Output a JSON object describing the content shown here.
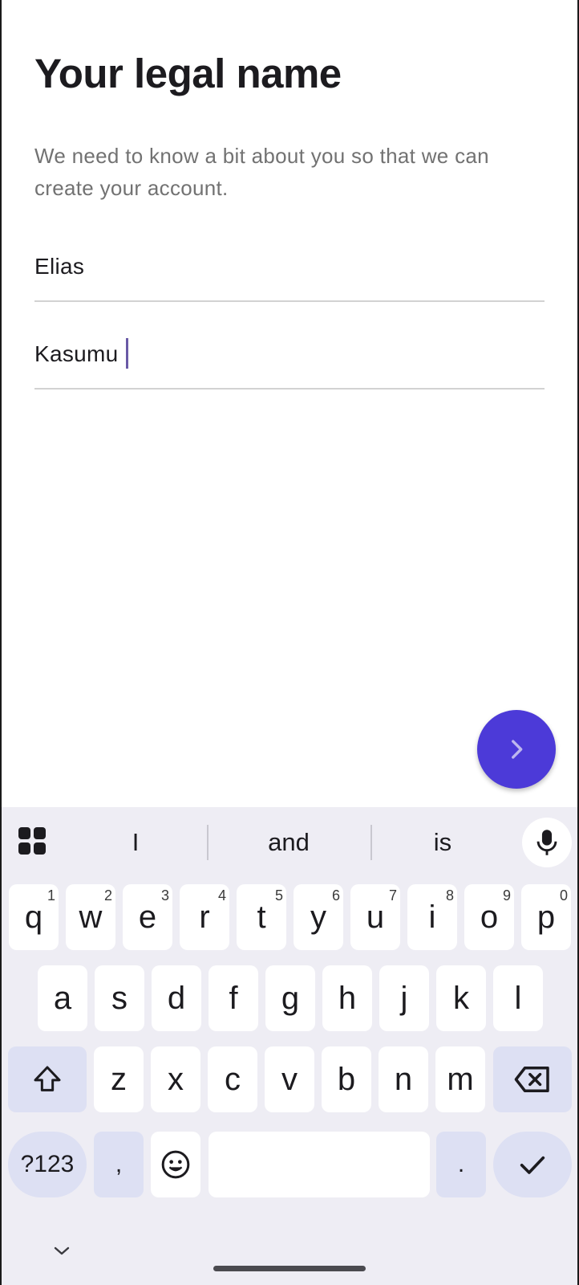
{
  "page": {
    "title": "Your legal name",
    "subtitle": "We need to know a bit about you so that we can create your account."
  },
  "form": {
    "first_name_value": "Elias",
    "last_name_value": "Kasumu"
  },
  "fab": {
    "icon": "chevron-right-icon",
    "color": "#4c3ad8"
  },
  "keyboard": {
    "suggestions": [
      "I",
      "and",
      "is"
    ],
    "row1": [
      {
        "c": "q",
        "n": "1"
      },
      {
        "c": "w",
        "n": "2"
      },
      {
        "c": "e",
        "n": "3"
      },
      {
        "c": "r",
        "n": "4"
      },
      {
        "c": "t",
        "n": "5"
      },
      {
        "c": "y",
        "n": "6"
      },
      {
        "c": "u",
        "n": "7"
      },
      {
        "c": "i",
        "n": "8"
      },
      {
        "c": "o",
        "n": "9"
      },
      {
        "c": "p",
        "n": "0"
      }
    ],
    "row2": [
      "a",
      "s",
      "d",
      "f",
      "g",
      "h",
      "j",
      "k",
      "l"
    ],
    "row3": [
      "z",
      "x",
      "c",
      "v",
      "b",
      "n",
      "m"
    ],
    "symbols_label": "?123",
    "comma_label": ",",
    "period_label": ".",
    "icons": {
      "grid": "apps-grid-icon",
      "mic": "microphone-icon",
      "shift": "shift-icon",
      "backspace": "backspace-icon",
      "emoji": "emoji-icon",
      "enter": "checkmark-icon",
      "hide": "chevron-down-icon"
    }
  }
}
